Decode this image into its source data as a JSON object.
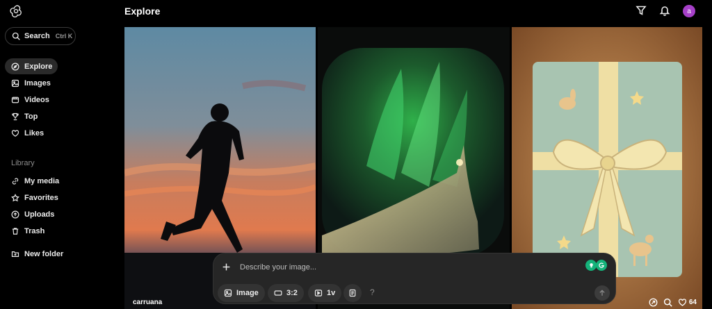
{
  "header": {
    "title": "Explore"
  },
  "search": {
    "label": "Search",
    "shortcut": "Ctrl K"
  },
  "nav": {
    "items": [
      {
        "label": "Explore",
        "icon": "compass-icon",
        "active": true
      },
      {
        "label": "Images",
        "icon": "image-icon"
      },
      {
        "label": "Videos",
        "icon": "video-icon"
      },
      {
        "label": "Top",
        "icon": "trophy-icon"
      },
      {
        "label": "Likes",
        "icon": "heart-icon"
      }
    ]
  },
  "library": {
    "label": "Library",
    "items": [
      {
        "label": "My media",
        "icon": "link-icon"
      },
      {
        "label": "Favorites",
        "icon": "star-icon"
      },
      {
        "label": "Uploads",
        "icon": "upload-icon"
      },
      {
        "label": "Trash",
        "icon": "trash-icon"
      },
      {
        "label": "New folder",
        "icon": "folder-plus-icon"
      }
    ]
  },
  "avatar": {
    "initial": "a",
    "color": "#a640c8"
  },
  "grid": {
    "tiles": [
      {
        "author": "carruana",
        "subject": "runner silhouette at sunset"
      },
      {
        "author": "",
        "subject": "aurora seen from airplane window"
      },
      {
        "author": "",
        "subject": "gift box with ribbon and deer",
        "likes": "64"
      }
    ]
  },
  "composer": {
    "placeholder": "Describe your image...",
    "mode_label": "Image",
    "aspect_label": "3:2",
    "variations_label": "1v",
    "help_label": "?"
  }
}
